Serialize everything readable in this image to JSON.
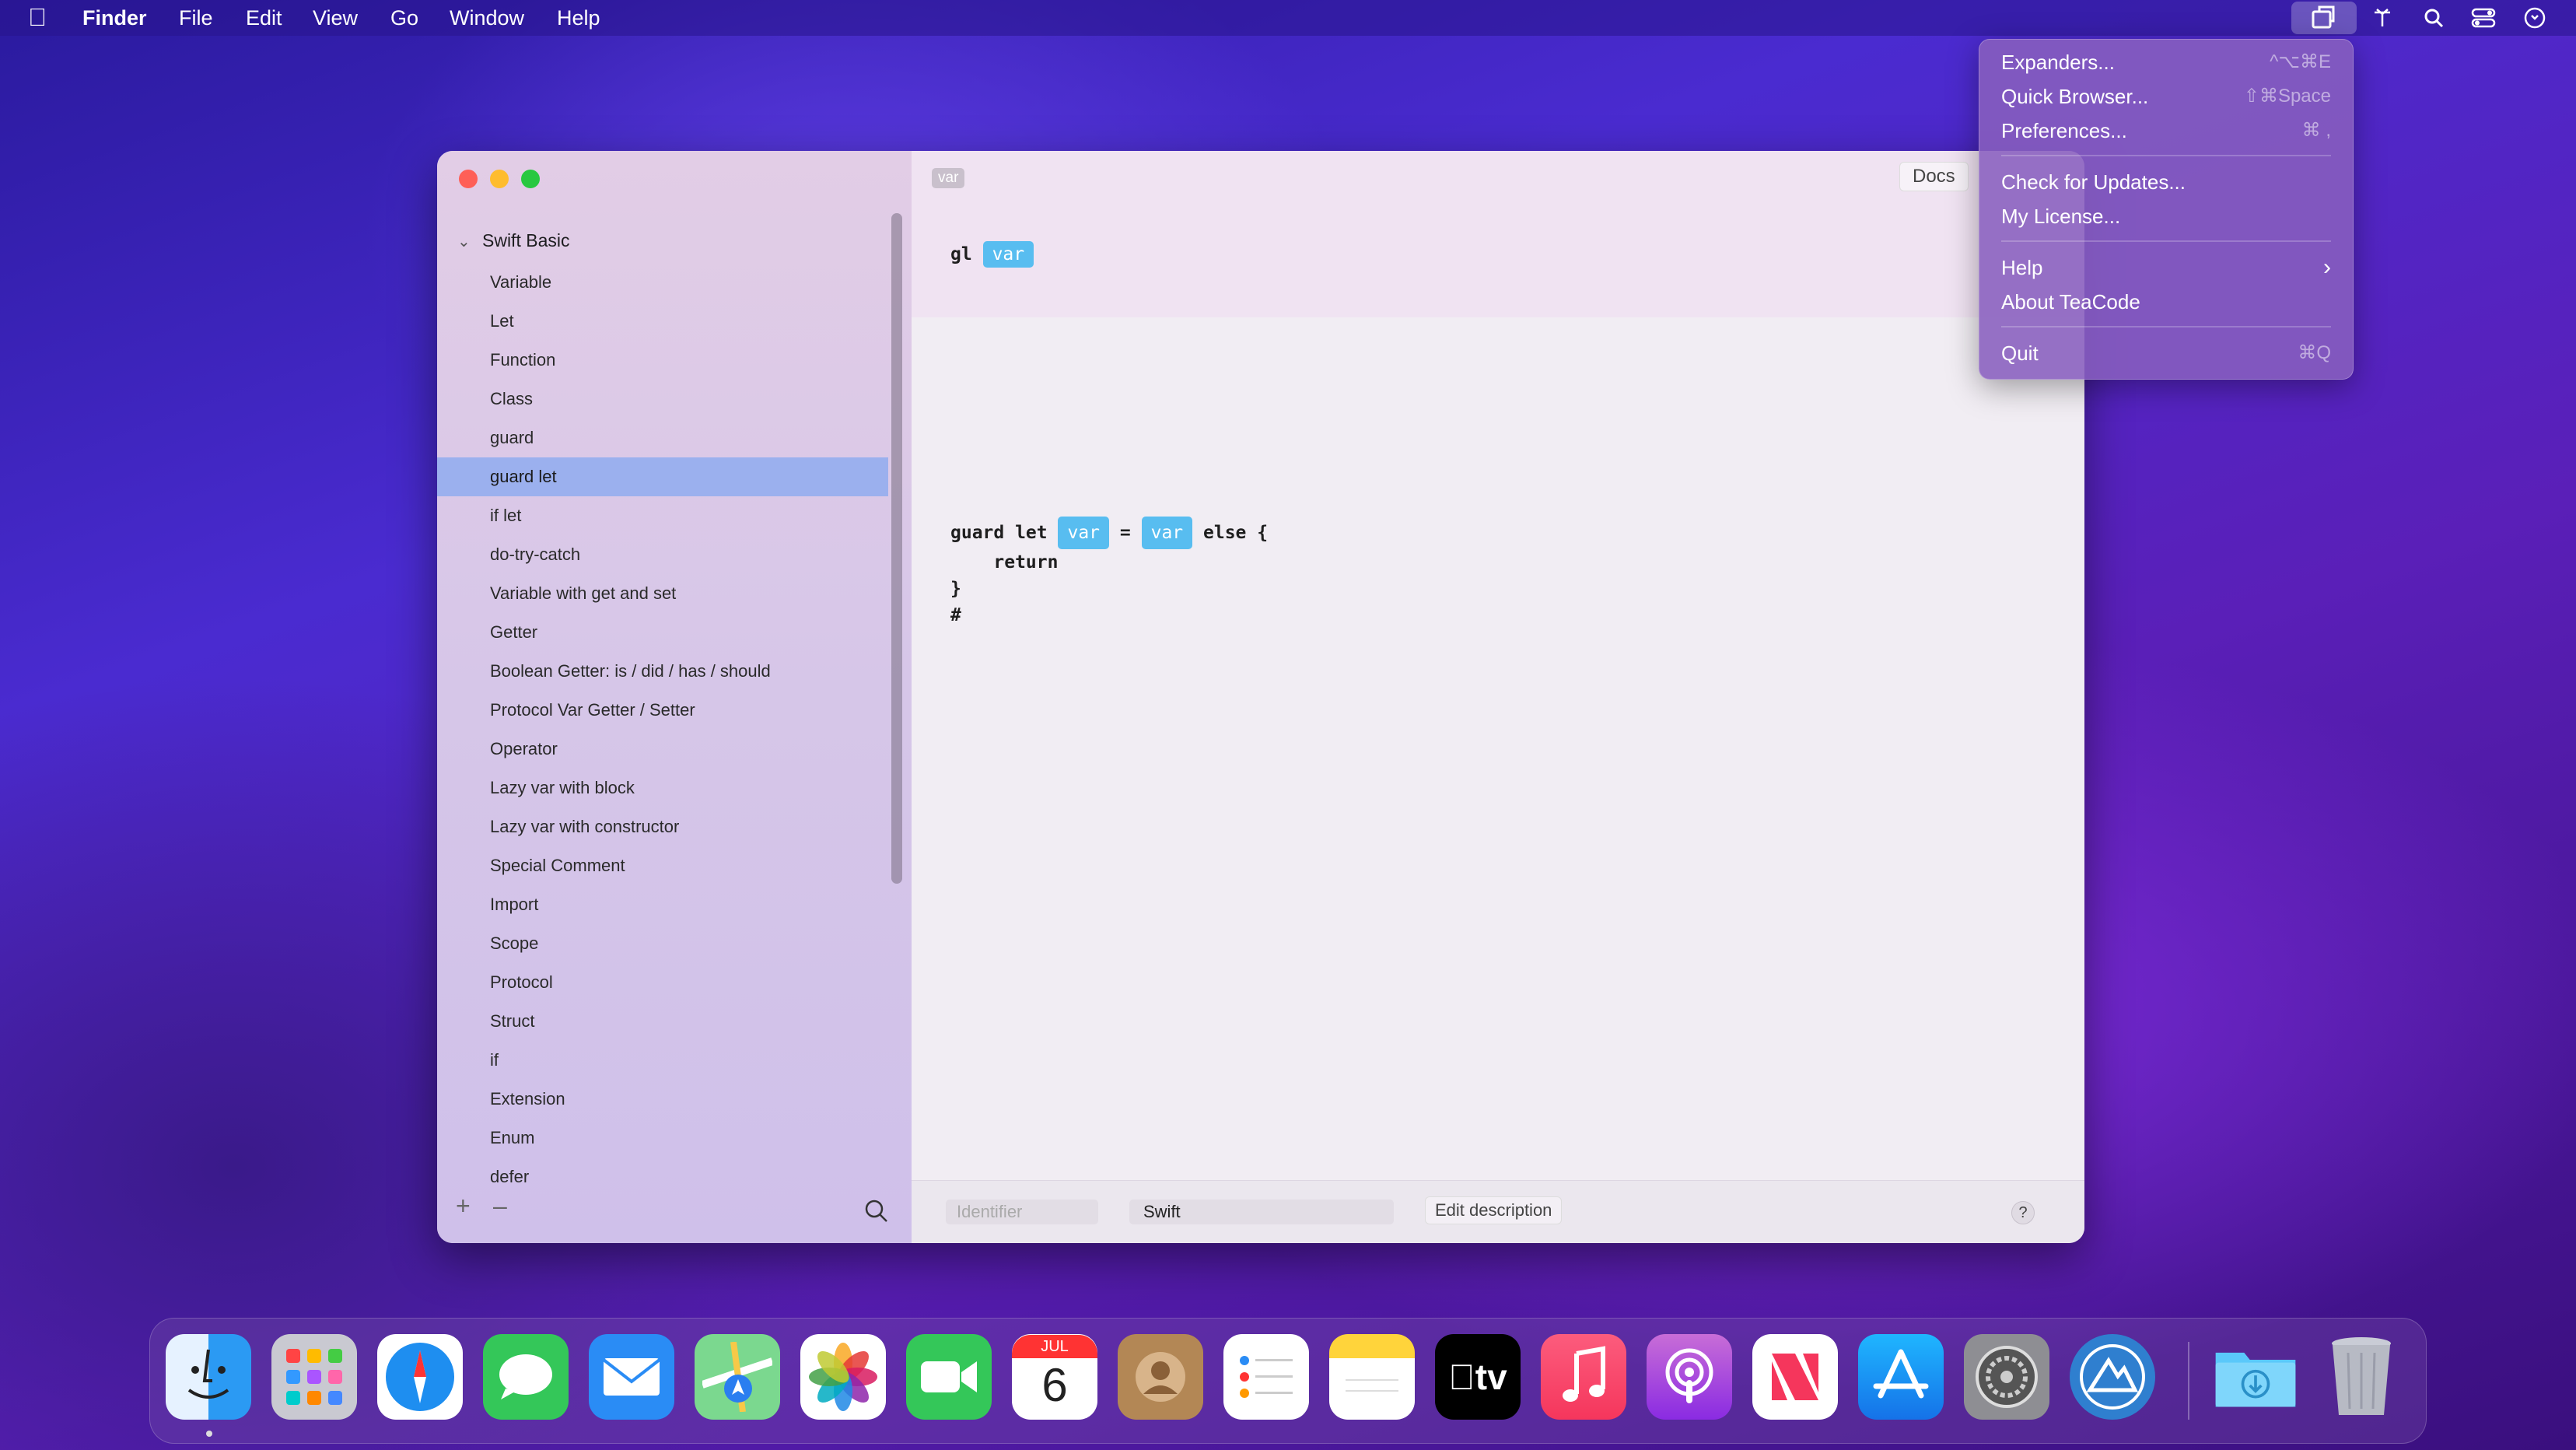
{
  "menubar": {
    "app_name": "Finder",
    "items": [
      "File",
      "Edit",
      "View",
      "Go",
      "Window",
      "Help"
    ]
  },
  "dropdown": {
    "items": [
      {
        "label": "Expanders...",
        "shortcut": "^⌥⌘E"
      },
      {
        "label": "Quick Browser...",
        "shortcut": "⇧⌘Space"
      },
      {
        "label": "Preferences...",
        "shortcut": "⌘ ,"
      },
      {
        "label": "Check for Updates...",
        "shortcut": ""
      },
      {
        "label": "My License...",
        "shortcut": ""
      },
      {
        "label": "Help",
        "shortcut": ""
      },
      {
        "label": "About TeaCode",
        "shortcut": ""
      },
      {
        "label": "Quit",
        "shortcut": "⌘Q"
      }
    ]
  },
  "sidebar": {
    "group": "Swift Basic",
    "items": [
      "Variable",
      "Let",
      "Function",
      "Class",
      "guard",
      "guard let",
      "if let",
      "do-try-catch",
      "Variable with get and set",
      "Getter",
      "Boolean Getter: is / did / has / should",
      "Protocol Var Getter / Setter",
      "Operator",
      "Lazy var with block",
      "Lazy var with constructor",
      "Special Comment",
      "Import",
      "Scope",
      "Protocol",
      "Struct",
      "if",
      "Extension",
      "Enum",
      "defer"
    ],
    "selected": "guard let"
  },
  "main": {
    "tag": "var",
    "docs_label": "Docs",
    "trigger": {
      "prefix": "gl",
      "token": "var"
    },
    "code": {
      "l1_a": "guard let",
      "tok1": "var",
      "l1_eq": "=",
      "tok2": "var",
      "l1_b": "else {",
      "l2": "    return",
      "l3": "}",
      "l4": "#"
    },
    "footer": {
      "identifier_placeholder": "Identifier",
      "language": "Swift",
      "edit_description": "Edit description",
      "help": "?"
    }
  },
  "dock": {
    "calendar_month": "JUL",
    "calendar_day": "6",
    "tv_label": "tv"
  }
}
